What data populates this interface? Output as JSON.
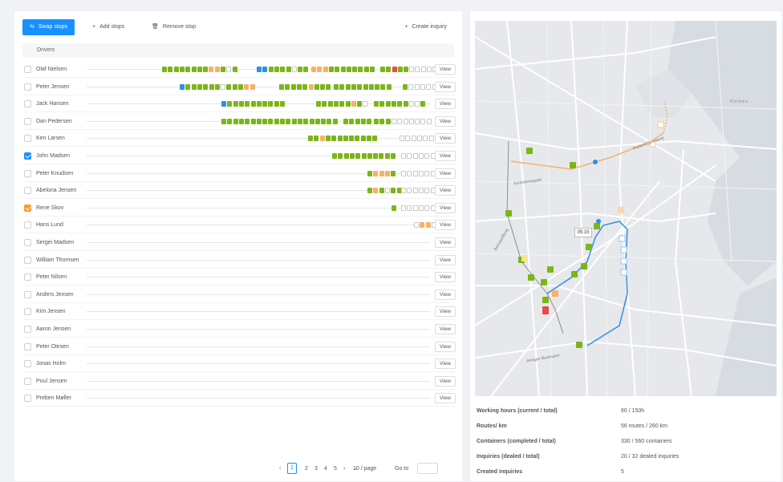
{
  "toolbar": {
    "swap": "Swap stops",
    "add": "Add stops",
    "remove": "Remove stop",
    "create": "Create inquiry"
  },
  "table": {
    "header": "Drivers",
    "view_label": "View"
  },
  "drivers": [
    {
      "name": "Olaf Nielsen",
      "check": "none",
      "blocks": [
        [
          184,
          "ggggggggoogeg"
        ],
        [
          302,
          "bbggggegg"
        ],
        [
          370,
          "ooogggggggg"
        ],
        [
          456,
          "ggrgg"
        ],
        [
          492,
          "eeeeee"
        ]
      ]
    },
    {
      "name": "Peter Jensen",
      "check": "none",
      "blocks": [
        [
          206,
          "bggggggegggoo"
        ],
        [
          330,
          "gggggoggg"
        ],
        [
          398,
          "gggggggggg"
        ],
        [
          484,
          "geeeeee"
        ]
      ]
    },
    {
      "name": "Jack Hansen",
      "check": "none",
      "blocks": [
        [
          258,
          "bgggggggggg"
        ],
        [
          376,
          "ggggggoge"
        ],
        [
          448,
          "ggggggeeg"
        ]
      ]
    },
    {
      "name": "Dan Pedersen",
      "check": "none",
      "blocks": [
        [
          258,
          "gggggggggggggggggggg"
        ],
        [
          410,
          "ggggg"
        ],
        [
          448,
          "gggeeeeeee"
        ]
      ]
    },
    {
      "name": "Ken Larsen",
      "check": "none",
      "blocks": [
        [
          366,
          "ggoggggggggg"
        ],
        [
          480,
          "eeeeeee"
        ]
      ]
    },
    {
      "name": "John Madsen",
      "check": "blue",
      "blocks": [
        [
          396,
          "ggggggggggg"
        ],
        [
          482,
          "eeeeee"
        ]
      ]
    },
    {
      "name": "Peter Knudsen",
      "check": "none",
      "blocks": [
        [
          440,
          "gooog"
        ],
        [
          482,
          "eeeeeee"
        ]
      ]
    },
    {
      "name": "Abelona Jensen",
      "check": "none",
      "blocks": [
        [
          440,
          "gogegg"
        ],
        [
          482,
          "eeeeeee"
        ]
      ]
    },
    {
      "name": "Rene Skov",
      "check": "orange",
      "blocks": [
        [
          470,
          "g"
        ],
        [
          482,
          "eeeeeee"
        ]
      ]
    },
    {
      "name": "Hans Lund",
      "check": "none",
      "blocks": [
        [
          498,
          "eooe"
        ]
      ]
    },
    {
      "name": "Sergei Madsen",
      "check": "none",
      "blocks": [
        [
          524,
          "e"
        ]
      ]
    },
    {
      "name": "William Thomsen",
      "check": "none",
      "blocks": []
    },
    {
      "name": "Peter Nilsen",
      "check": "none",
      "blocks": []
    },
    {
      "name": "Anders Jensen",
      "check": "none",
      "blocks": []
    },
    {
      "name": "Kim Jensen",
      "check": "none",
      "blocks": []
    },
    {
      "name": "Aaron Jensen",
      "check": "none",
      "blocks": []
    },
    {
      "name": "Peter Olesen",
      "check": "none",
      "blocks": []
    },
    {
      "name": "Jonas Holm",
      "check": "none",
      "blocks": []
    },
    {
      "name": "Poul Jensen",
      "check": "none",
      "blocks": []
    },
    {
      "name": "Preben Møller",
      "check": "none",
      "blocks": []
    }
  ],
  "pagination": {
    "prev": "‹",
    "pages": [
      "1",
      "2",
      "3",
      "4",
      "5"
    ],
    "current": "1",
    "next": "›",
    "page_size": "10 / page",
    "goto": "Go to"
  },
  "map": {
    "marker_label": "05:15",
    "district_label": "Holmen",
    "street_labels": [
      "Sortedamsgade",
      "Bernstorffsvej",
      "Frederikssundsvej",
      "Amager Boulevard"
    ]
  },
  "stats": [
    {
      "label": "Working hours (current / total)",
      "value": "60 / 150h"
    },
    {
      "label": "Routes/ km",
      "value": "56 routes / 260 km"
    },
    {
      "label": "Containers (completed / total)",
      "value": "330 / 560 containers"
    },
    {
      "label": "Inquiries (dealed / total)",
      "value": "20 / 32 dealed inquiries"
    },
    {
      "label": "Created inquiries",
      "value": "5"
    }
  ],
  "colors": {
    "primary": "#1890ff",
    "done": "#7cb518",
    "pending": "#f7b267",
    "alert": "#e94a4a",
    "route": "#2f8fe8"
  }
}
